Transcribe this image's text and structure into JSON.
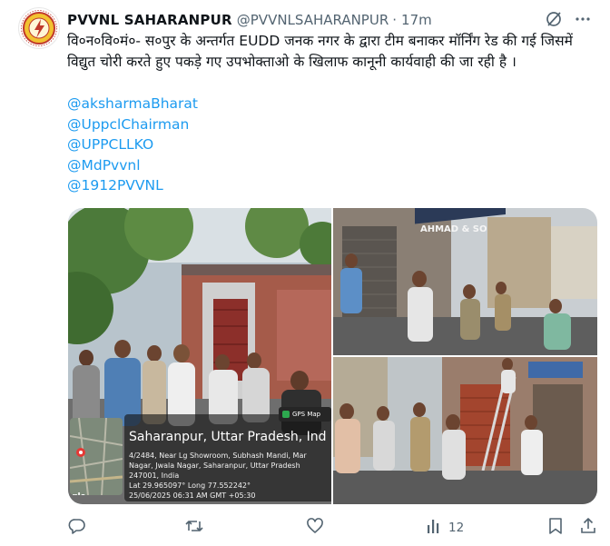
{
  "author": {
    "name": "PVVNL SAHARANPUR",
    "handle": "@PVVNLSAHARANPUR",
    "separator": "·",
    "time": "17m"
  },
  "tweet": {
    "text": "वि०न०वि०मं०- स०पुर के अन्तर्गत EUDD  जनक नगर के द्वारा टीम बनाकर मॉर्निंग रेड की गई जिसमें विद्युत चोरी करते हुए पकड़े गए उपभोक्ताओ के खिलाफ कानूनी कार्यवाही की जा रही है  ।",
    "mentions": [
      "@aksharmaBharat",
      "@UppclChairman",
      "@UPPCLLKO",
      "@MdPvvnl",
      "@1912PVVNL"
    ]
  },
  "gps_overlay": {
    "badge": "GPS Map",
    "title": "Saharanpur, Uttar Pradesh, Ind",
    "line1": "4/2484, Near Lg Showroom, Subhash Mandi, Mar",
    "line2": "Nagar, Jwala Nagar, Saharanpur, Uttar Pradesh",
    "line3": "247001, India",
    "line4": "Lat 29.965097° Long 77.552242°",
    "line5": "25/06/2025 06:31 AM GMT +05:30",
    "map_logo": "gle"
  },
  "shop_sign": "AHMAD & SONS",
  "actions": {
    "views_count": "12"
  },
  "icons": {
    "header": [
      "grok-slash-icon",
      "more-dots-icon"
    ],
    "actions": [
      "reply-icon",
      "retweet-icon",
      "like-icon",
      "views-icon",
      "bookmark-icon",
      "share-icon"
    ]
  },
  "colors": {
    "link": "#1d9bf0",
    "muted": "#536471",
    "text": "#0f1419"
  }
}
